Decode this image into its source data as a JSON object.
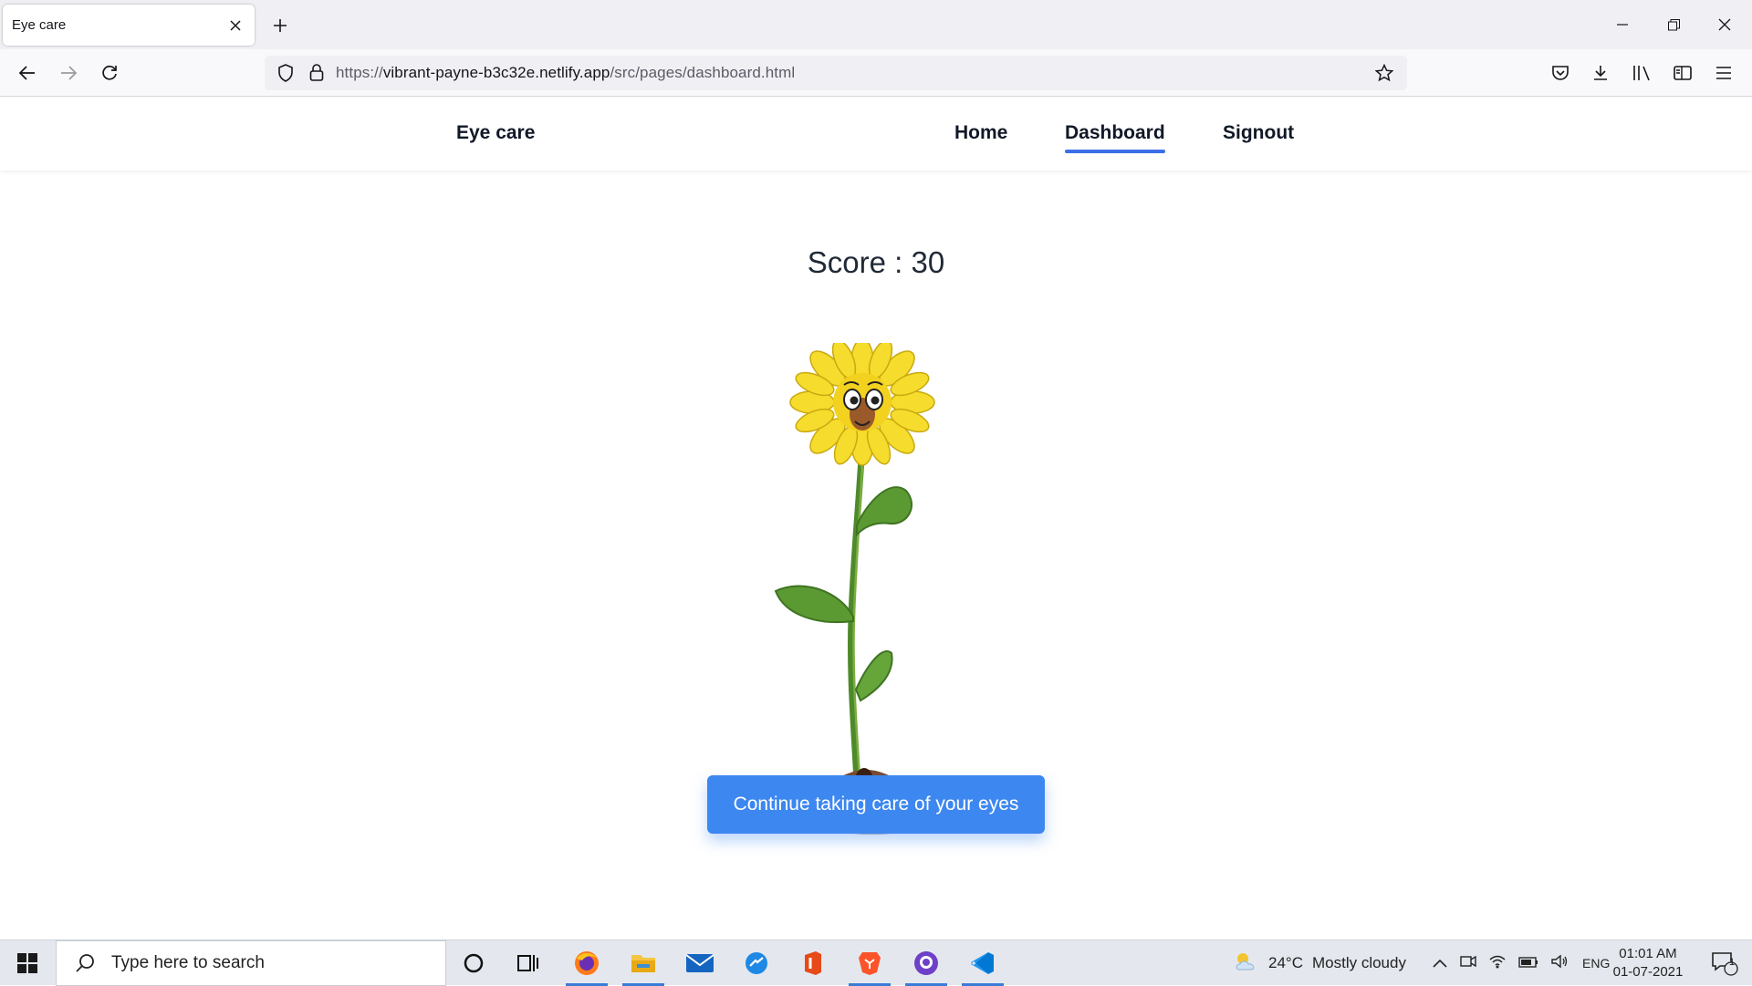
{
  "browser": {
    "tab_title": "Eye care",
    "url_prefix": "https://",
    "url_domain": "vibrant-payne-b3c32e.netlify.app",
    "url_path": "/src/pages/dashboard.html"
  },
  "site": {
    "brand": "Eye care",
    "nav": [
      {
        "label": "Home",
        "active": false
      },
      {
        "label": "Dashboard",
        "active": true
      },
      {
        "label": "Signout",
        "active": false
      }
    ]
  },
  "main": {
    "score_label": "Score :",
    "score_value": "30",
    "cta_label": "Continue taking care of your eyes",
    "accent_color": "#3d87f0"
  },
  "taskbar": {
    "search_placeholder": "Type here to search",
    "weather_temp": "24°C",
    "weather_text": "Mostly cloudy",
    "language": "ENG",
    "time": "01:01 AM",
    "date": "01-07-2021",
    "notification_count": "1",
    "pinned_icons": [
      "cortana-icon",
      "task-view-icon",
      "firefox-icon",
      "file-explorer-icon",
      "mail-icon",
      "edge-icon",
      "office-icon",
      "brave-icon",
      "github-desktop-icon",
      "vscode-icon"
    ]
  }
}
